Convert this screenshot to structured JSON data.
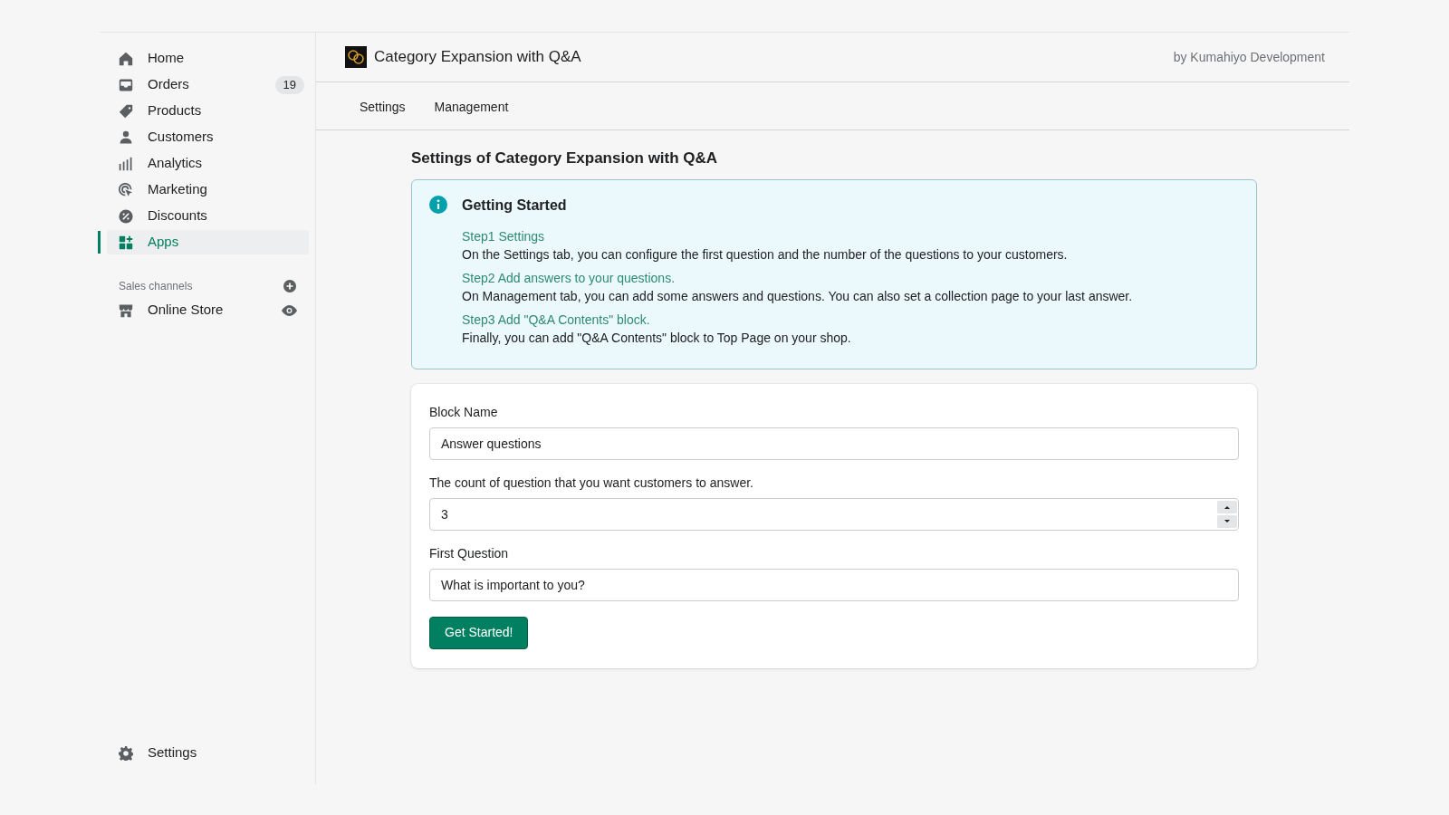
{
  "sidebar": {
    "items": [
      {
        "label": "Home",
        "selected": false
      },
      {
        "label": "Orders",
        "badge": "19",
        "selected": false
      },
      {
        "label": "Products",
        "selected": false
      },
      {
        "label": "Customers",
        "selected": false
      },
      {
        "label": "Analytics",
        "selected": false
      },
      {
        "label": "Marketing",
        "selected": false
      },
      {
        "label": "Discounts",
        "selected": false
      },
      {
        "label": "Apps",
        "selected": true
      }
    ],
    "section_title": "Sales channels",
    "channels": [
      {
        "label": "Online Store"
      }
    ],
    "footer_item": {
      "label": "Settings"
    }
  },
  "app_header": {
    "title": "Category Expansion with Q&A",
    "developer": "by Kumahiyo Development"
  },
  "tabs": [
    {
      "label": "Settings"
    },
    {
      "label": "Management"
    }
  ],
  "page_title": "Settings of Category Expansion with Q&A",
  "info_banner": {
    "title": "Getting Started",
    "steps": [
      {
        "heading": "Step1 Settings",
        "text": "On the Settings tab, you can configure the first question and the number of the questions to your customers."
      },
      {
        "heading": "Step2 Add answers to your questions.",
        "text": "On Management tab, you can add some answers and questions. You can also set a collection page to your last answer."
      },
      {
        "heading": "Step3 Add \"Q&A Contents\" block.",
        "text": "Finally, you can add \"Q&A Contents\" block to Top Page on your shop."
      }
    ]
  },
  "form": {
    "fields": [
      {
        "kind": "text",
        "label": "Block Name",
        "value": "Answer questions"
      },
      {
        "kind": "number",
        "label": "The count of question that you want customers to answer.",
        "value": "3"
      },
      {
        "kind": "text",
        "label": "First Question",
        "value": "What is important to you?"
      }
    ],
    "submit_button": "Get Started!"
  }
}
